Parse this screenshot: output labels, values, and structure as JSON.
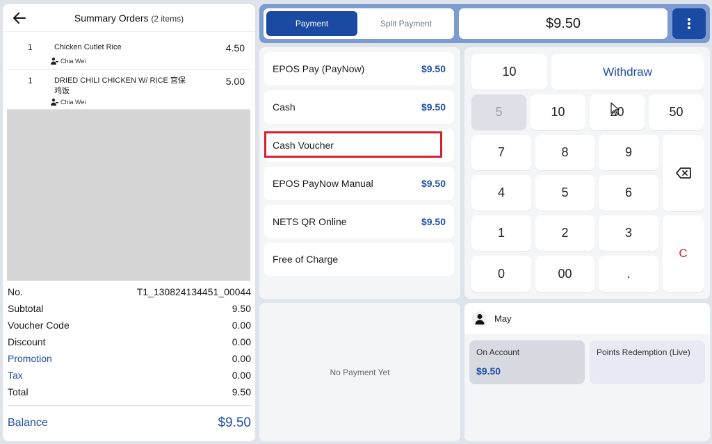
{
  "summary": {
    "title": "Summary Orders",
    "item_count": "(2 items)",
    "items": [
      {
        "qty": "1",
        "name": "Chicken Cutlet Rice",
        "price": "4.50",
        "waiter": "Chia Wei"
      },
      {
        "qty": "1",
        "name": "DRIED CHILI CHICKEN W/ RICE 宫保鸡饭",
        "price": "5.00",
        "waiter": "Chia Wei"
      }
    ],
    "rows": [
      {
        "label": "No.",
        "value": "T1_130824134451_00044"
      },
      {
        "label": "Subtotal",
        "value": "9.50"
      },
      {
        "label": "Voucher Code",
        "value": "0.00"
      },
      {
        "label": "Discount",
        "value": "0.00"
      },
      {
        "label": "Promotion",
        "value": "0.00"
      },
      {
        "label": "Tax",
        "value": "0.00"
      },
      {
        "label": "Total",
        "value": "9.50"
      }
    ],
    "balance_label": "Balance",
    "balance_value": "$9.50"
  },
  "topbar": {
    "tab_payment": "Payment",
    "tab_split": "Split Payment",
    "amount": "$9.50"
  },
  "methods": [
    {
      "label": "EPOS Pay (PayNow)",
      "amount": "$9.50"
    },
    {
      "label": "Cash",
      "amount": "$9.50"
    },
    {
      "label": "Cash Voucher",
      "amount": ""
    },
    {
      "label": "EPOS PayNow Manual",
      "amount": "$9.50"
    },
    {
      "label": "NETS QR Online",
      "amount": "$9.50"
    },
    {
      "label": "Free of Charge",
      "amount": ""
    }
  ],
  "no_payment": "No Payment Yet",
  "keypad": {
    "quick_10": "10",
    "withdraw": "Withdraw",
    "q5": "5",
    "q10": "10",
    "q20": "20",
    "q50": "50",
    "k7": "7",
    "k8": "8",
    "k9": "9",
    "k4": "4",
    "k5": "5",
    "k6": "6",
    "k1": "1",
    "k2": "2",
    "k3": "3",
    "k0": "0",
    "k00": "00",
    "kdot": ".",
    "clear": "C"
  },
  "customer": {
    "name": "May",
    "on_account_label": "On Account",
    "on_account_value": "$9.50",
    "points_label": "Points Redemption (Live)"
  },
  "colors": {
    "primary": "#1b4aa3",
    "accent_blue": "#1e4fa6",
    "highlight_red": "#d81f2a"
  }
}
